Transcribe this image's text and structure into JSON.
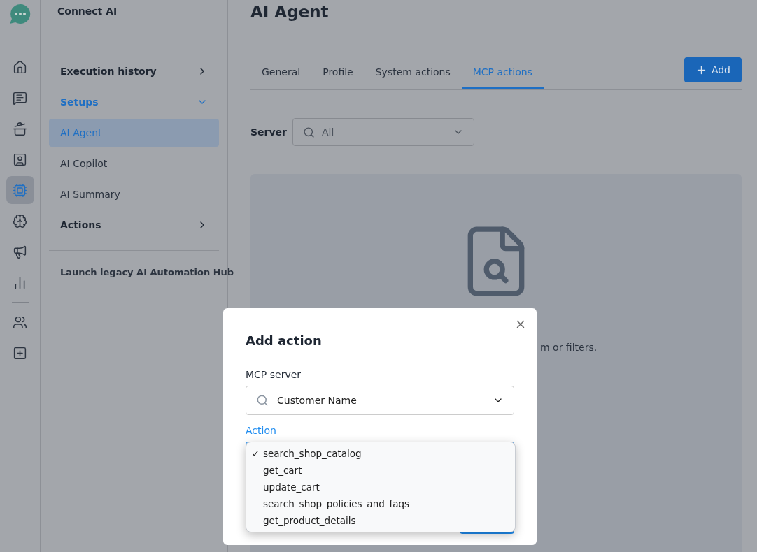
{
  "app": {
    "name": "Connect AI"
  },
  "rail": [
    {
      "kind": "home",
      "selected": false
    },
    {
      "kind": "chat",
      "selected": false
    },
    {
      "kind": "stack",
      "selected": false
    },
    {
      "kind": "contacts",
      "selected": false
    },
    {
      "kind": "ai",
      "selected": true
    },
    {
      "kind": "brain",
      "selected": false
    },
    {
      "kind": "megaphone",
      "selected": false
    },
    {
      "kind": "chart",
      "selected": false
    },
    {
      "kind": "divider"
    },
    {
      "kind": "people",
      "selected": false
    },
    {
      "kind": "apps",
      "selected": false
    }
  ],
  "sidebar": {
    "items": [
      {
        "kind": "group",
        "label": "Execution history",
        "expanded": false
      },
      {
        "kind": "group",
        "label": "Setups",
        "expanded": true,
        "children": [
          {
            "label": "AI Agent",
            "selected": true
          },
          {
            "label": "AI Copilot",
            "selected": false
          },
          {
            "label": "AI Summary",
            "selected": false
          }
        ]
      },
      {
        "kind": "group",
        "label": "Actions",
        "expanded": false
      },
      {
        "kind": "link",
        "label": "Launch legacy AI Automation Hub"
      }
    ]
  },
  "main": {
    "title": "AI Agent",
    "tabs": [
      {
        "label": "General",
        "selected": false
      },
      {
        "label": "Profile",
        "selected": false
      },
      {
        "label": "System actions",
        "selected": false
      },
      {
        "label": "MCP actions",
        "selected": true
      }
    ],
    "add_button": "Add",
    "filter": {
      "label": "Server",
      "value": "All"
    },
    "empty_state": {
      "text": "m or filters."
    }
  },
  "modal": {
    "title": "Add action",
    "mcp_server": {
      "label": "MCP server",
      "value": "Customer Name"
    },
    "action": {
      "label": "Action",
      "focused": true
    },
    "check_mark": "✓",
    "options": [
      {
        "label": "search_shop_catalog",
        "selected": true
      },
      {
        "label": "get_cart",
        "selected": false
      },
      {
        "label": "update_cart",
        "selected": false
      },
      {
        "label": "search_shop_policies_and_faqs",
        "selected": false
      },
      {
        "label": "get_product_details",
        "selected": false
      }
    ]
  }
}
